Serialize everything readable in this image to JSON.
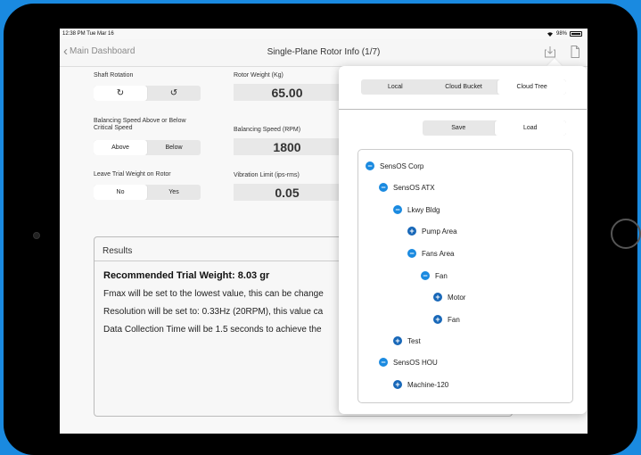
{
  "status": {
    "time": "12:38 PM  Tue Mar 16",
    "battery": "98%"
  },
  "nav": {
    "back_label": "Main Dashboard",
    "title": "Single-Plane Rotor Info (1/7)"
  },
  "form": {
    "shaft_rotation": {
      "label": "Shaft Rotation",
      "options": [
        "↻",
        "↺"
      ],
      "selected": 0
    },
    "balancing_above_below": {
      "label": "Balancing Speed Above or Below Critical Speed",
      "options": [
        "Above",
        "Below"
      ],
      "selected": 0
    },
    "leave_trial": {
      "label": "Leave Trial Weight on Rotor",
      "options": [
        "No",
        "Yes"
      ],
      "selected": 0
    },
    "rotor_weight": {
      "label": "Rotor Weight (Kg)",
      "value": "65.00"
    },
    "balancing_speed": {
      "label": "Balancing Speed (RPM)",
      "value": "1800"
    },
    "vibration_limit": {
      "label": "Vibration Limit (ips-rms)",
      "value": "0.05"
    }
  },
  "results": {
    "title": "Results",
    "recommended": "Recommended Trial Weight: 8.03 gr",
    "lines": [
      "Fmax will be set to the lowest value, this can be change",
      "Resolution will be set to: 0.33Hz (20RPM), this value ca",
      "Data Collection Time will be 1.5 seconds to achieve the"
    ]
  },
  "popover": {
    "source_tabs": [
      "Local",
      "Cloud Bucket",
      "Cloud Tree"
    ],
    "source_selected": 2,
    "action_tabs": [
      "Save",
      "Load"
    ],
    "action_selected": 1,
    "tree": [
      {
        "label": "SensOS Corp",
        "state": "expanded"
      },
      {
        "label": "SensOS ATX",
        "state": "expanded"
      },
      {
        "label": "Lkwy Bldg",
        "state": "expanded"
      },
      {
        "label": "Pump Area",
        "state": "collapsed"
      },
      {
        "label": "Fans Area",
        "state": "expanded"
      },
      {
        "label": "Fan",
        "state": "expanded"
      },
      {
        "label": "Motor",
        "state": "collapsed"
      },
      {
        "label": "Fan",
        "state": "collapsed"
      },
      {
        "label": "Test",
        "state": "collapsed"
      },
      {
        "label": "SensOS HOU",
        "state": "expanded"
      },
      {
        "label": "Machine-120",
        "state": "collapsed"
      }
    ]
  },
  "colors": {
    "accent": "#1a8ae0",
    "accent_dark": "#1767b8",
    "background": "#1a8ae0"
  }
}
